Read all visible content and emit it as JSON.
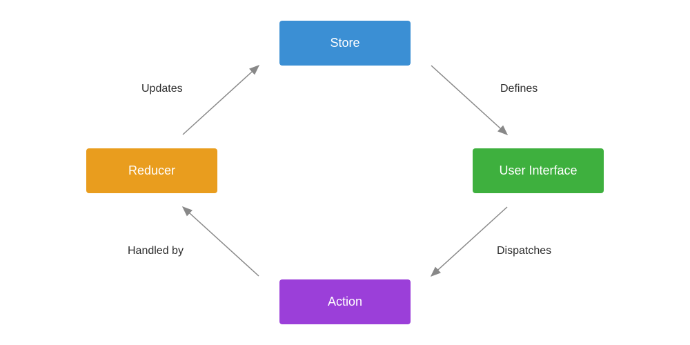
{
  "nodes": {
    "store": {
      "label": "Store",
      "color": "#3b8fd4"
    },
    "user_interface": {
      "label": "User Interface",
      "color": "#3eb03e"
    },
    "action": {
      "label": "Action",
      "color": "#9b3fd9"
    },
    "reducer": {
      "label": "Reducer",
      "color": "#e99d1e"
    }
  },
  "edges": {
    "store_to_ui": {
      "label": "Defines"
    },
    "ui_to_action": {
      "label": "Dispatches"
    },
    "action_to_reducer": {
      "label": "Handled by"
    },
    "reducer_to_store": {
      "label": "Updates"
    }
  }
}
